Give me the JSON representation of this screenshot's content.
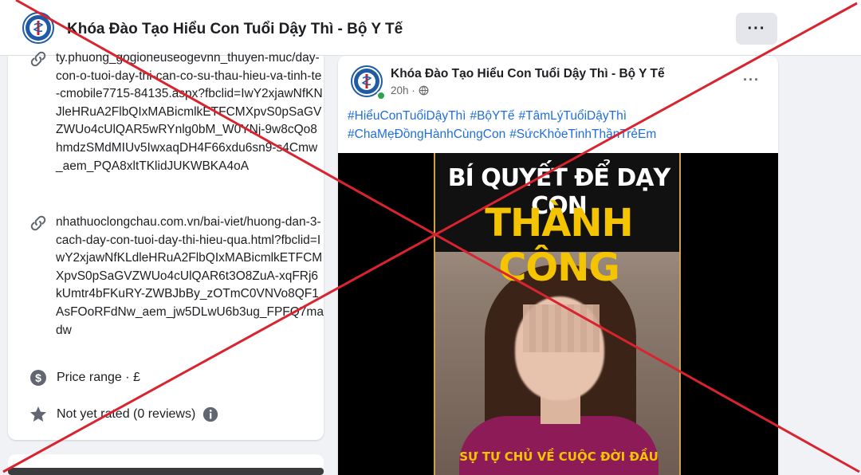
{
  "header": {
    "page_title": "Khóa Đào Tạo Hiểu Con Tuổi Dậy Thì - Bộ Y Tế",
    "more_label": "···"
  },
  "intro": {
    "link1": "ty.phuong_gogioneuseogevnn_thuyen-muc/day-con-o-tuoi-day-thi-can-co-su-thau-hieu-va-tinh-te-cmobile7715-84135.aspx?fbclid=IwY2xjawNfKNJleHRuA2FlbQIxMABicmlkETFCMXpvS0pSaGVZWUo4cUlQAR5wRYnlg0bM_W0YNj-9w8cQo8hmdzSMdMIUv5IwxaqDH4F66xdu6sn9-s4Cmw_aem_PQA8xltTKlidJUKWBKA4oA",
    "link2": "nhathuoclongchau.com.vn/bai-viet/huong-dan-3-cach-day-con-tuoi-day-thi-hieu-qua.html?fbclid=IwY2xjawNfKLdleHRuA2FlbQIxMABicmlkETFCMXpvS0pSaGVZWUo4cUlQAR6t3O8ZuA-xqFRj6kUmtr4bFKuRY-ZWBJbBy_zOTmC0VNVo8QF1AsFOoRFdNw_aem_jw5DLwU6b3ug_FPFQ7madw",
    "price_range": "Price range · £",
    "rating": "Not yet rated (0 reviews)"
  },
  "post": {
    "author": "Khóa Đào Tạo Hiểu Con Tuổi Dậy Thì - Bộ Y Tế",
    "time": "20h ·",
    "more_label": "···",
    "hashtags": [
      "#HiểuConTuổiDậyThì",
      "#BộYTế",
      "#TâmLýTuổiDậyThì",
      "#ChaMẹĐồngHànhCùngCon",
      "#SứcKhỏeTinhThầnTrẻEm"
    ],
    "video": {
      "headline_top": "BÍ QUYẾT ĐỂ DẠY CON",
      "headline_main": "THÀNH CÔNG",
      "caption": "SỰ TỰ CHỦ VỀ CUỘC ĐỜI ĐẦU"
    }
  },
  "colors": {
    "overlay_x": "#d9232e",
    "hashtag": "#216fdb",
    "headline_main": "#f5c400"
  },
  "icons": [
    "ministry-of-health-logo",
    "link-icon",
    "dollar-icon",
    "star-icon",
    "info-icon",
    "globe-icon",
    "more-icon"
  ]
}
